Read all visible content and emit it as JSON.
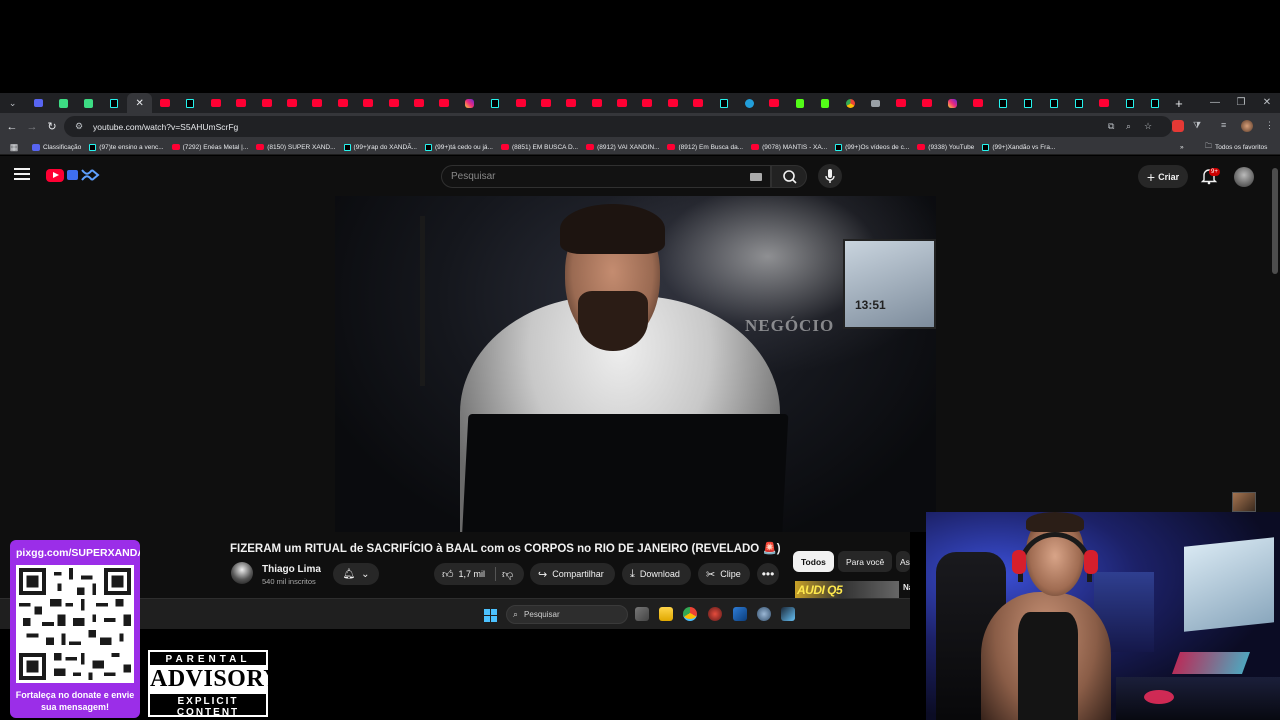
{
  "browser": {
    "tabs": [
      "yt",
      "tt",
      "yt",
      "yt",
      "yt",
      "yt",
      "yt",
      "yt",
      "yt",
      "yt",
      "yt",
      "yt",
      "ig",
      "tt",
      "yt",
      "yt",
      "yt",
      "yt",
      "yt",
      "yt",
      "yt",
      "yt",
      "tt",
      "tg",
      "yt",
      "kk",
      "kk",
      "ch",
      "gy",
      "yt",
      "yt",
      "ig",
      "yt",
      "tt",
      "tt",
      "tt",
      "tt",
      "yt",
      "tt",
      "tt"
    ],
    "active_tab_close": "✕",
    "new_tab": "+",
    "address": "youtube.com/watch?v=S5AHUmScrFg",
    "bookmarks": [
      {
        "icon": "discord",
        "label": "Classificação"
      },
      {
        "icon": "tiktok",
        "label": "(97)te ensino a venc..."
      },
      {
        "icon": "youtube",
        "label": "(7292) Enéas Metal |..."
      },
      {
        "icon": "youtube",
        "label": "(8150) SUPER XAND..."
      },
      {
        "icon": "tiktok",
        "label": "(99+)rap do XANDÃ..."
      },
      {
        "icon": "tiktok",
        "label": "(99+)tá cedo ou já..."
      },
      {
        "icon": "youtube",
        "label": "(8851) EM BUSCA D..."
      },
      {
        "icon": "youtube",
        "label": "(8912) VAI XANDIN..."
      },
      {
        "icon": "youtube",
        "label": "(8912) Em Busca da..."
      },
      {
        "icon": "youtube",
        "label": "(9078) MANTIS - XA..."
      },
      {
        "icon": "tiktok",
        "label": "(99+)Os vídeos de c..."
      },
      {
        "icon": "youtube",
        "label": "(9338) YouTube"
      },
      {
        "icon": "tiktok",
        "label": "(99+)Xandão vs Fra..."
      }
    ],
    "bookmarks_overflow": "»",
    "all_bookmarks": "Todos os favoritos"
  },
  "youtube": {
    "search_placeholder": "Pesquisar",
    "create_label": "Criar",
    "notifications_badge": "9+",
    "video": {
      "title": "FIZERAM um RITUAL de SACRIFÍCIO à BAAL com os CORPOS no RIO DE JANEIRO (REVELADO 🚨)",
      "channel": "Thiago Lima",
      "subscribers": "540 mil inscritos",
      "likes": "1,7 mil",
      "share_label": "Compartilhar",
      "download_label": "Download",
      "clip_label": "Clipe",
      "more_label": "•••",
      "overlay_brand_text": "NEGÓCIO",
      "overlay_clock": "13:51"
    },
    "chips": [
      "Todos",
      "Para você",
      "As"
    ],
    "recommended": {
      "thumb_text": "AUDI Q5",
      "title_fragment": "Na"
    }
  },
  "taskbar": {
    "search_label": "Pesquisar"
  },
  "overlay": {
    "qr_url": "pixgg.com/SUPERXANDA",
    "qr_message": "Fortaleça no donate e envie sua mensagem!",
    "advisory_top": "PARENTAL",
    "advisory_main": "ADVISORY",
    "advisory_bottom": "EXPLICIT CONTENT"
  },
  "colors": {
    "youtube_red": "#ff0033",
    "qr_panel": "#9b2ee8",
    "page_bg": "#0f0f0f"
  }
}
